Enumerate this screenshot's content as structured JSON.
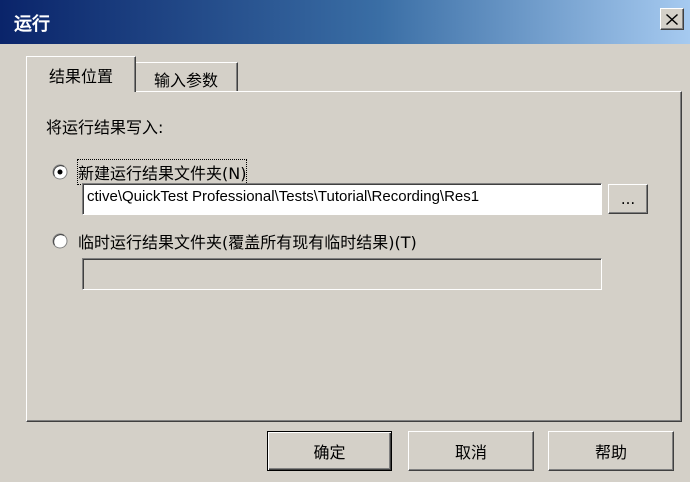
{
  "window": {
    "title": "运行",
    "close_symbol": "✕"
  },
  "tabs": [
    {
      "label": "结果位置",
      "active": true
    },
    {
      "label": "输入参数",
      "active": false
    }
  ],
  "results_location": {
    "heading": "将运行结果写入:",
    "option_new": {
      "label": "新建运行结果文件夹(N)",
      "checked": true,
      "path_value": "ctive\\QuickTest Professional\\Tests\\Tutorial\\Recording\\Res1",
      "browse_label": "..."
    },
    "option_temp": {
      "label": "临时运行结果文件夹(覆盖所有现有临时结果)(T)",
      "checked": false,
      "path_value": ""
    }
  },
  "buttons": {
    "ok": "确定",
    "cancel": "取消",
    "help": "帮助"
  },
  "icons": {
    "close": "close-icon",
    "radio_selected": "radio-selected-icon",
    "radio_unselected": "radio-unselected-icon"
  }
}
